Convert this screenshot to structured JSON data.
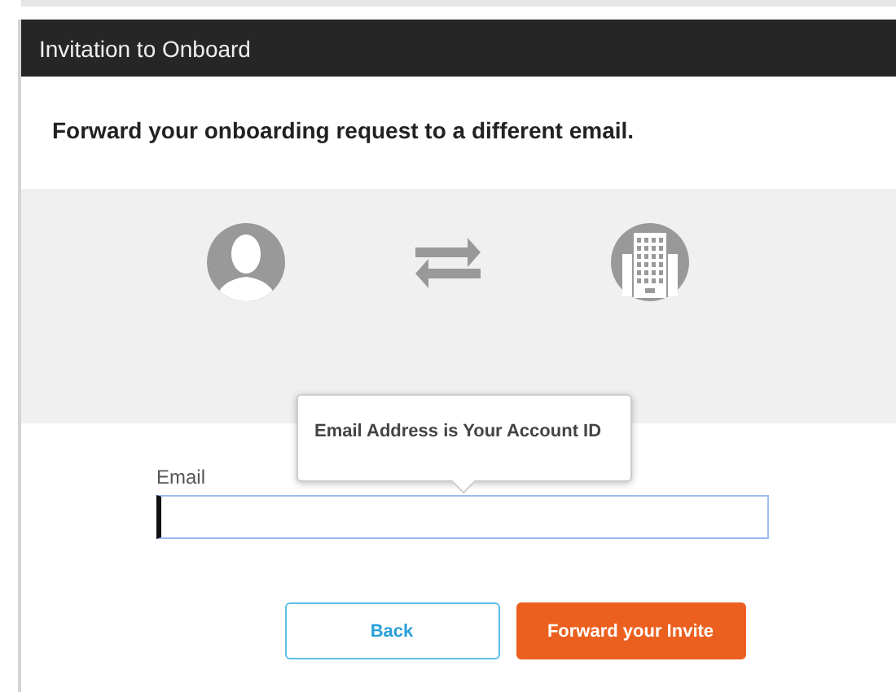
{
  "window": {
    "title": "Invitation to Onboard"
  },
  "heading": "Forward your onboarding request to a different email.",
  "tooltip": {
    "text": "Email Address is Your Account ID"
  },
  "email_field": {
    "label": "Email",
    "focused": true
  },
  "buttons": [
    {
      "label": "Back",
      "kind": "secondary"
    },
    {
      "label": "Forward your Invite",
      "kind": "primary"
    }
  ]
}
